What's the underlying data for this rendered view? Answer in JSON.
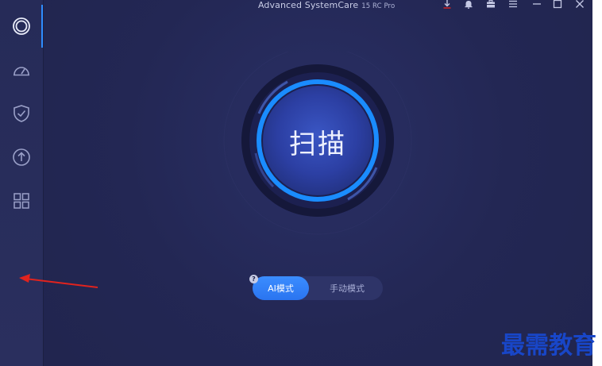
{
  "window": {
    "title": "Advanced SystemCare",
    "version": "15 RC Pro"
  },
  "sidebar": {
    "items": [
      {
        "name": "care",
        "icon": "care-ring-icon",
        "active": true
      },
      {
        "name": "speedup",
        "icon": "speedometer-icon",
        "active": false
      },
      {
        "name": "protect",
        "icon": "shield-check-icon",
        "active": false
      },
      {
        "name": "update",
        "icon": "upload-circle-icon",
        "active": false
      },
      {
        "name": "toolbox",
        "icon": "grid-icon",
        "active": false
      }
    ]
  },
  "toolbar_icons": [
    "download-icon",
    "bell-icon",
    "briefcase-icon",
    "menu-icon",
    "minimize-icon",
    "maximize-icon",
    "close-icon"
  ],
  "scan": {
    "label": "扫描"
  },
  "mode": {
    "help": "?",
    "ai_label": "AI模式",
    "manual_label": "手动模式",
    "selected": "ai"
  },
  "watermark": {
    "text": "最需教育"
  },
  "colors": {
    "accent": "#2f8cff",
    "background": "#22264e",
    "annotation_arrow": "#e0231e",
    "watermark": "#1846c8"
  }
}
